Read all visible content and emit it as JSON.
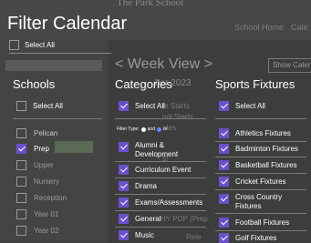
{
  "background": {
    "school_name": "The Park School",
    "nav": [
      "School Home",
      "Cale"
    ],
    "week_view": "< Week View >",
    "select_text": "Show Calen",
    "date_text": "ber 2023",
    "lines": [
      "m Starts",
      "ool Starts",
      "ates",
      "s!",
      "HY POP (Prep",
      "Rele"
    ]
  },
  "filter": {
    "title": "Filter Calendar",
    "select_all_top": "Select All",
    "filter_type_label": "Filter Type:",
    "filter_and": "and",
    "filter_or": "or"
  },
  "schools": {
    "heading": "Schools",
    "select_all": "Select All",
    "items": [
      {
        "label": "Pelican",
        "checked": false
      },
      {
        "label": "Prep",
        "checked": true
      },
      {
        "label": "Upper",
        "checked": false
      },
      {
        "label": "Nursery",
        "checked": false
      },
      {
        "label": "Reception",
        "checked": false
      },
      {
        "label": "Year 01",
        "checked": false
      },
      {
        "label": "Year 02",
        "checked": false
      }
    ]
  },
  "categories": {
    "heading": "Categories",
    "select_all": "Select All",
    "items": [
      {
        "label": "Alumni &",
        "label2": "Development",
        "checked": true
      },
      {
        "label": "Curriculum Event",
        "checked": true
      },
      {
        "label": "Drama",
        "checked": true
      },
      {
        "label": "Exams/Assessments",
        "checked": true
      },
      {
        "label": "General",
        "checked": true
      },
      {
        "label": "Music",
        "checked": true
      }
    ]
  },
  "sports": {
    "heading": "Sports Fixtures",
    "select_all": "Select All",
    "items": [
      {
        "label": "Athletics Fixtures",
        "checked": true
      },
      {
        "label": "Badminton Fixtures",
        "checked": true
      },
      {
        "label": "Basketball Fixtures",
        "checked": true
      },
      {
        "label": "Cricket Fixtures",
        "checked": true
      },
      {
        "label": "Cross Country",
        "label2": "Fixtures",
        "checked": true
      },
      {
        "label": "Football Fixtures",
        "checked": true
      },
      {
        "label": "Golf Fixtures",
        "checked": true
      }
    ]
  },
  "colors": {
    "checkbox_checked": "#6b50c9",
    "overlay_bg": "#3d3d3d"
  }
}
